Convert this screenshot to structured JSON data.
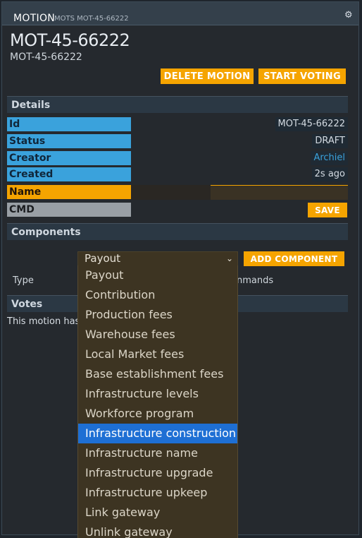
{
  "header": {
    "title": "MOTION",
    "subtitle": "MOTS MOT-45-66222",
    "settings_icon": "gear-icon"
  },
  "motion": {
    "big_title": "MOT-45-66222",
    "small_title": "MOT-45-66222"
  },
  "actions": {
    "delete_label": "DELETE MOTION",
    "start_voting_label": "START VOTING"
  },
  "details": {
    "section_title": "Details",
    "rows": [
      {
        "label": "Id",
        "value": "MOT-45-66222"
      },
      {
        "label": "Status",
        "value": "DRAFT"
      },
      {
        "label": "Creator",
        "value": "Archiel"
      },
      {
        "label": "Created",
        "value": "2s ago"
      },
      {
        "label": "Name",
        "value": ""
      },
      {
        "label": "CMD",
        "value": ""
      }
    ],
    "save_label": "SAVE"
  },
  "components": {
    "section_title": "Components",
    "selected": "Payout",
    "add_label": "ADD COMPONENT",
    "columns": [
      "Type",
      "nmands"
    ],
    "options": [
      "Payout",
      "Contribution",
      "Production fees",
      "Warehouse fees",
      "Local Market fees",
      "Base establishment fees",
      "Infrastructure levels",
      "Workforce program",
      "Infrastructure construction",
      "Infrastructure name",
      "Infrastructure upgrade",
      "Infrastructure upkeep",
      "Link gateway",
      "Unlink gateway"
    ],
    "highlighted_option": "Infrastructure construction"
  },
  "votes": {
    "section_title": "Votes",
    "text": "This motion has"
  },
  "colors": {
    "accent": "#f5a400",
    "label_blue": "#3aa2dc",
    "highlight": "#1e6fd4"
  }
}
